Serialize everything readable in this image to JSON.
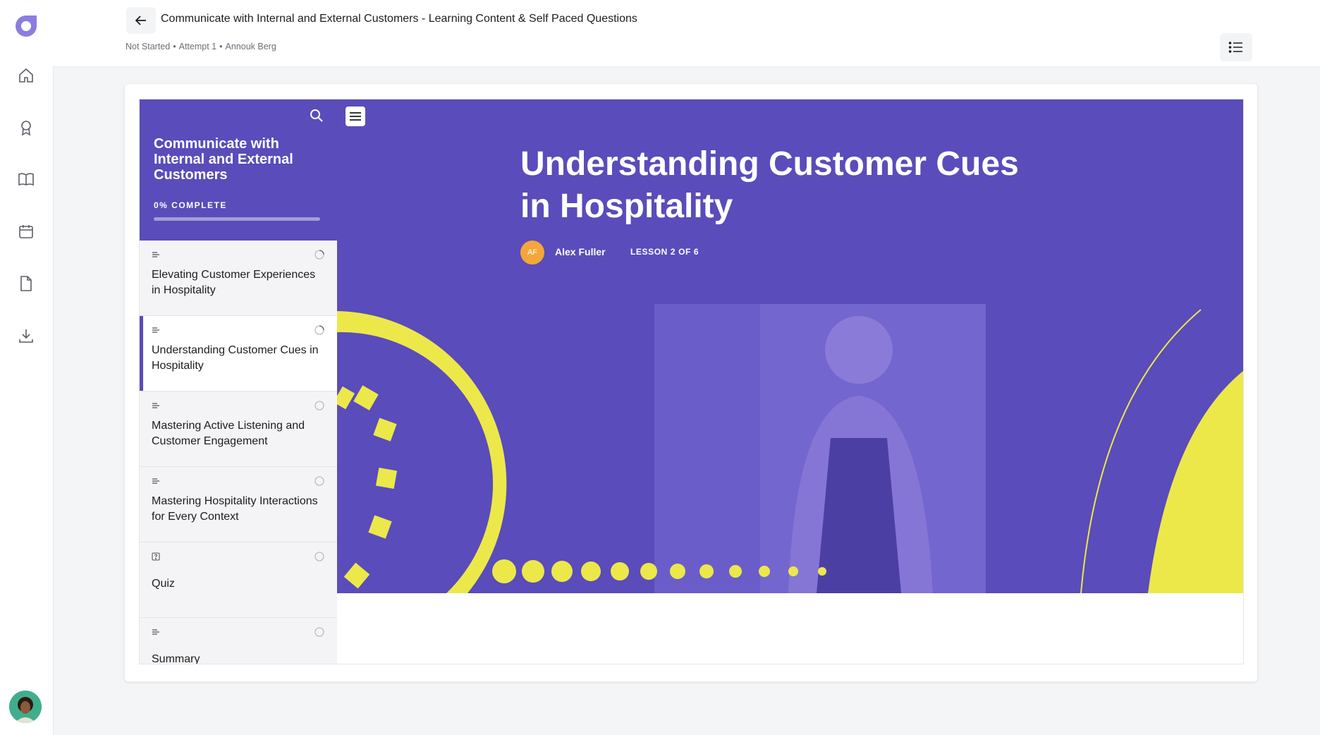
{
  "header": {
    "title": "Communicate with Internal and External Customers - Learning Content & Self Paced Questions",
    "status": "Not Started",
    "attempt": "Attempt 1",
    "learner": "Annouk Berg",
    "separator": "•"
  },
  "rail": {
    "items": [
      {
        "name": "home",
        "icon": "home-icon"
      },
      {
        "name": "achievements",
        "icon": "award-icon"
      },
      {
        "name": "library",
        "icon": "book-icon"
      },
      {
        "name": "calendar",
        "icon": "calendar-icon"
      },
      {
        "name": "documents",
        "icon": "file-icon"
      },
      {
        "name": "downloads",
        "icon": "download-icon"
      }
    ]
  },
  "sidebar": {
    "course_title": "Communicate with Internal and External Customers",
    "progress_label": "0% COMPLETE",
    "progress_value": 0,
    "lessons": [
      {
        "label": "Elevating Customer Experiences in Hospitality",
        "type": "text-icon",
        "status": "in-progress"
      },
      {
        "label": "Understanding Customer Cues in Hospitality",
        "type": "text-icon",
        "status": "in-progress",
        "active": true
      },
      {
        "label": "Mastering Active Listening and Customer Engagement",
        "type": "text-icon",
        "status": "not-started"
      },
      {
        "label": "Mastering Hospitality Interactions for Every Context",
        "type": "text-icon",
        "status": "not-started"
      },
      {
        "label": "Quiz",
        "type": "quiz-icon",
        "status": "not-started"
      },
      {
        "label": "Summary",
        "type": "text-icon",
        "status": "not-started"
      }
    ]
  },
  "lesson": {
    "title": "Understanding Customer Cues in Hospitality",
    "author_initials": "AF",
    "author_name": "Alex Fuller",
    "lesson_count": "LESSON 2 OF 6"
  },
  "colors": {
    "accent": "#5a4cba",
    "highlight": "#ece84a",
    "avatar_orange": "#f3a73a"
  }
}
